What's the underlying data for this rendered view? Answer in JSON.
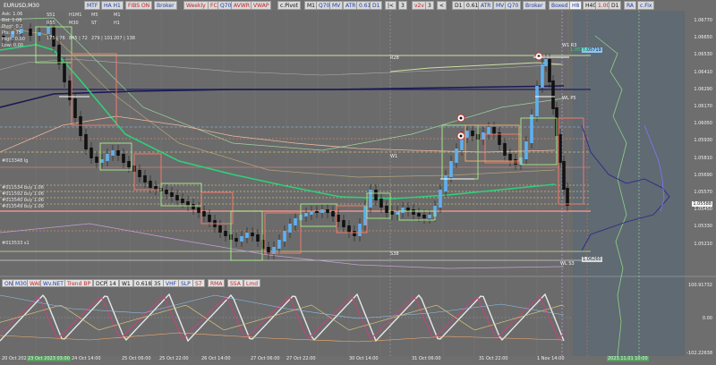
{
  "symbol": "EURUSD,M30",
  "toolbar": [
    "MTF",
    "HA H1",
    "FIBS ON",
    "Broker",
    "Weekly",
    "FC",
    "Q70",
    "AVWR",
    "VWAP",
    "c.Pivot",
    "M1",
    "Q70",
    "MV",
    "ATR",
    "0.61",
    "D1",
    "|<",
    "3",
    "v2v",
    "3",
    "<",
    "D1",
    "0.61",
    "ATR",
    "MV",
    "Q70",
    "Broker",
    "Boxed",
    "H8",
    "H40",
    "1.00",
    "D1",
    "RA",
    "c.Fix"
  ],
  "osc_toolbar": [
    "ON",
    "M30",
    "WAE",
    "Wv.NET",
    "Trend BP",
    "DCP",
    "14",
    "W1",
    "0.618",
    "35",
    "VHF",
    "SLP",
    "S7",
    "RMA",
    "SSA",
    "Lmd"
  ],
  "info_lines": [
    "Ask: 1.06",
    "Bid: 1.06",
    "Pivot: 0.2",
    "Pts: 0 75",
    "High: 0.00",
    "Low: 0.00"
  ],
  "info_cols": [
    "175 | 76",
    "845 | 72",
    "279 | 101",
    "207 | 138"
  ],
  "info_cols2": [
    "S51",
    "H1M1",
    "M5",
    "M1",
    "R55",
    "M30",
    "ST",
    "H1"
  ],
  "side_labels": [
    "#013348 lg",
    "#011534 buy 1.06",
    "#011592 buy 1.06",
    "#013540 buy 1.06",
    "#013549 buy 1.06",
    "#013533 s1"
  ],
  "price_labels": [
    "1.06770",
    "1.06650",
    "1.06530",
    "1.06410",
    "1.06290",
    "1.06170",
    "1.06050",
    "1.05930",
    "1.05810",
    "1.05690",
    "1.05570",
    "1.05450",
    "1.05330",
    "1.05210"
  ],
  "current_price": "1.05588",
  "box_labels": [
    "1.05719",
    "1.06260",
    "1.05726"
  ],
  "chart_tags": [
    "R28",
    "W1",
    "S38",
    "W1 R3",
    "WL P5",
    "WL S3"
  ],
  "osc_labels": [
    "100.91732",
    "0.00",
    "-102.22638"
  ],
  "x_labels": [
    "20 Oct 2023",
    "23 Oct 2023 03:00",
    "24 Oct 14:00",
    "25 Oct 06:00",
    "25 Oct 22:00",
    "26 Oct 14:00",
    "27 Oct 06:00",
    "27 Oct 22:00",
    "30 Oct 14:00",
    "31 Oct 06:00",
    "31 Oct 22:00",
    "1 Nov 14:00",
    "2023.11.01 10:00"
  ]
}
